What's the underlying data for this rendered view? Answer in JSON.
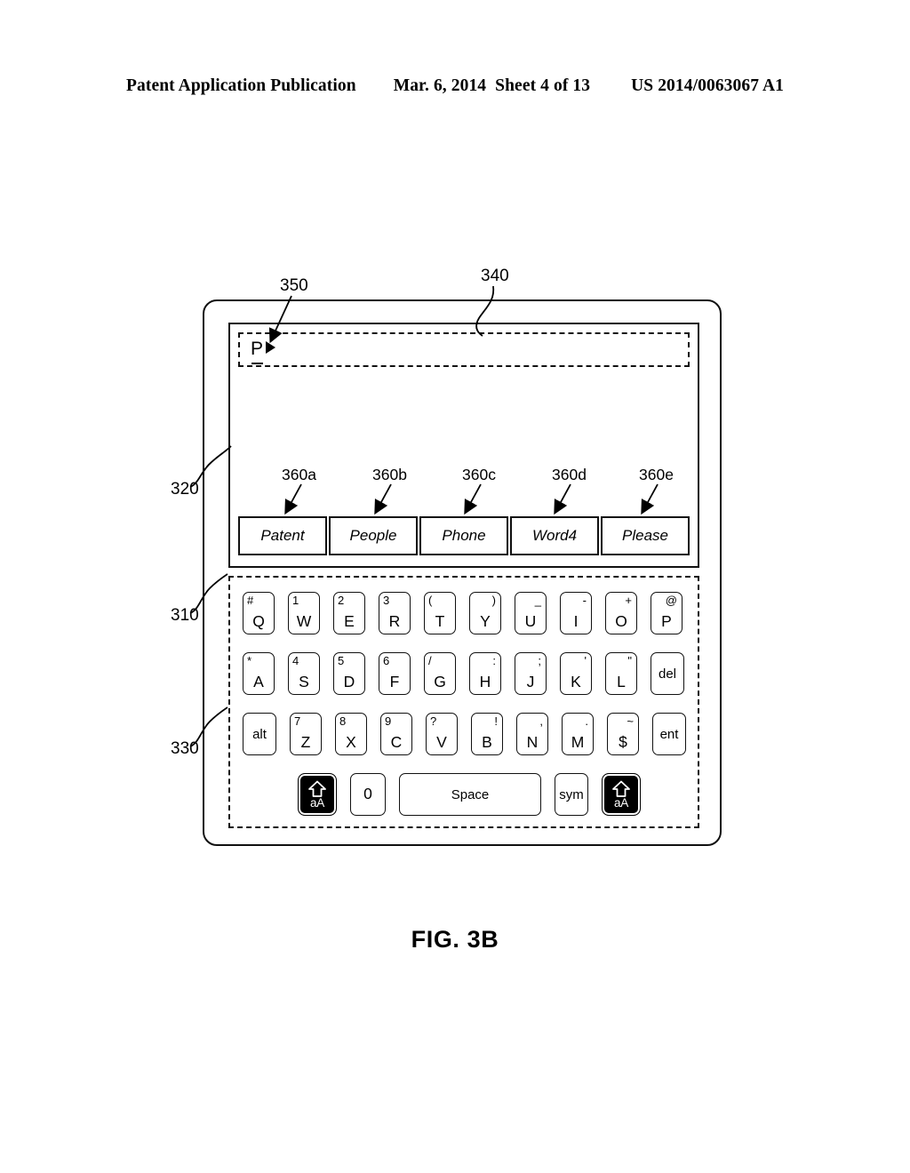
{
  "header": {
    "title": "Patent Application Publication",
    "date": "Mar. 6, 2014",
    "sheet": "Sheet 4 of 13",
    "patent_number": "US 2014/0063067 A1"
  },
  "figure": {
    "caption": "FIG. 3B"
  },
  "reference_numerals": {
    "device": "310",
    "display": "320",
    "keyboard": "330",
    "text_field": "340",
    "cursor": "350"
  },
  "text_field": {
    "typed_text": "P"
  },
  "suggestions": {
    "refs": [
      "360a",
      "360b",
      "360c",
      "360d",
      "360e"
    ],
    "items": [
      "Patent",
      "People",
      "Phone",
      "Word4",
      "Please"
    ]
  },
  "keyboard": {
    "rows": [
      [
        {
          "main": "Q",
          "alt": "#",
          "alt_side": "left"
        },
        {
          "main": "W",
          "alt": "1",
          "alt_side": "left"
        },
        {
          "main": "E",
          "alt": "2",
          "alt_side": "left"
        },
        {
          "main": "R",
          "alt": "3",
          "alt_side": "left"
        },
        {
          "main": "T",
          "alt": "(",
          "alt_side": "left"
        },
        {
          "main": "Y",
          "alt": ")",
          "alt_side": "right"
        },
        {
          "main": "U",
          "alt": "_",
          "alt_side": "right"
        },
        {
          "main": "I",
          "alt": "-",
          "alt_side": "right"
        },
        {
          "main": "O",
          "alt": "+",
          "alt_side": "right"
        },
        {
          "main": "P",
          "alt": "@",
          "alt_side": "right"
        }
      ],
      [
        {
          "main": "A",
          "alt": "*",
          "alt_side": "left"
        },
        {
          "main": "S",
          "alt": "4",
          "alt_side": "left"
        },
        {
          "main": "D",
          "alt": "5",
          "alt_side": "left"
        },
        {
          "main": "F",
          "alt": "6",
          "alt_side": "left"
        },
        {
          "main": "G",
          "alt": "/",
          "alt_side": "left"
        },
        {
          "main": "H",
          "alt": ":",
          "alt_side": "right"
        },
        {
          "main": "J",
          "alt": ";",
          "alt_side": "right"
        },
        {
          "main": "K",
          "alt": "'",
          "alt_side": "right"
        },
        {
          "main": "L",
          "alt": "\"",
          "alt_side": "right"
        },
        {
          "main": "del",
          "alt": "",
          "alt_side": "none"
        }
      ],
      [
        {
          "main": "alt",
          "alt": "",
          "alt_side": "none"
        },
        {
          "main": "Z",
          "alt": "7",
          "alt_side": "left"
        },
        {
          "main": "X",
          "alt": "8",
          "alt_side": "left"
        },
        {
          "main": "C",
          "alt": "9",
          "alt_side": "left"
        },
        {
          "main": "V",
          "alt": "?",
          "alt_side": "left"
        },
        {
          "main": "B",
          "alt": "!",
          "alt_side": "right"
        },
        {
          "main": "N",
          "alt": ",",
          "alt_side": "right"
        },
        {
          "main": "M",
          "alt": ".",
          "alt_side": "right"
        },
        {
          "main": "$",
          "alt": "~",
          "alt_side": "right"
        },
        {
          "main": "ent",
          "alt": "",
          "alt_side": "none"
        }
      ]
    ],
    "bottom_row": {
      "shift_left_label": "aA",
      "zero_label": "0",
      "space_label": "Space",
      "sym_label": "sym",
      "shift_right_label": "aA"
    }
  }
}
